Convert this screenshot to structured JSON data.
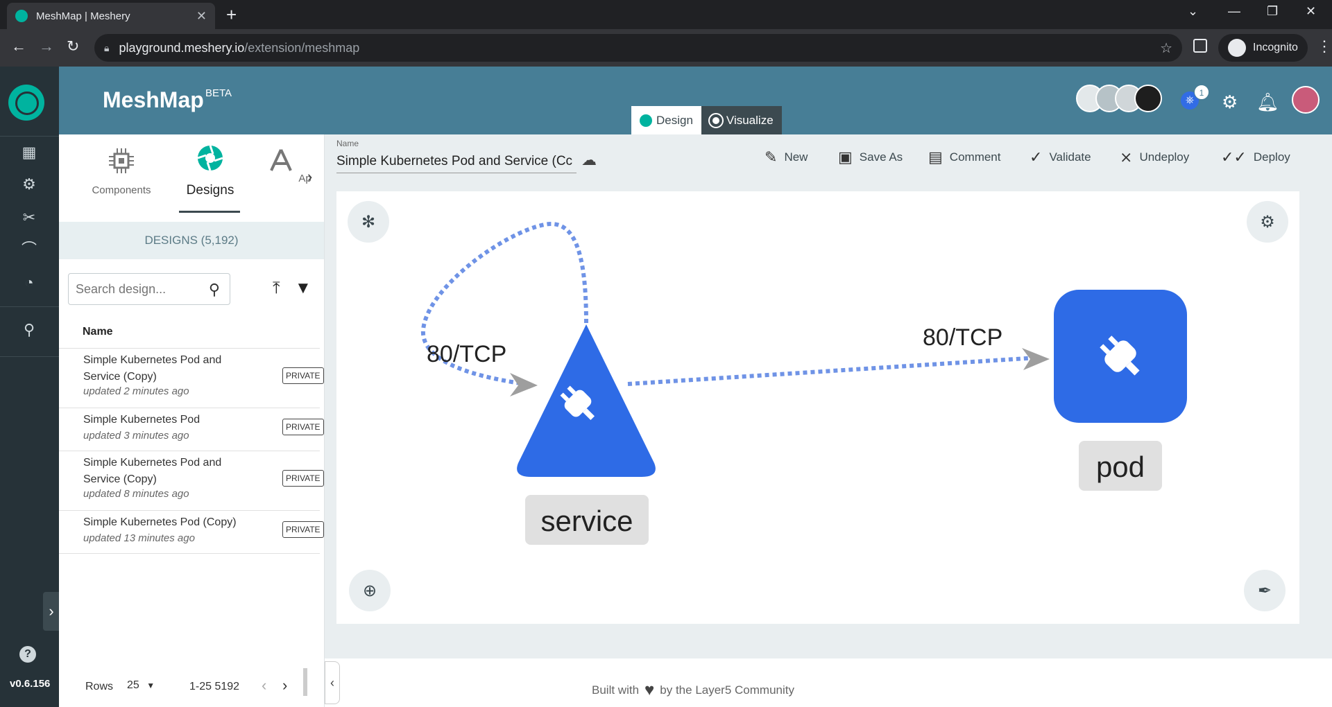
{
  "browser": {
    "tab_title": "MeshMap | Meshery",
    "url_host": "playground.meshery.io",
    "url_path": "/extension/meshmap",
    "incognito_label": "Incognito"
  },
  "sidebar": {
    "version": "v0.6.156",
    "icons": [
      "dashboard-icon",
      "lifecycle-icon",
      "configuration-icon",
      "performance-icon",
      "extensions-icon",
      "location-icon"
    ]
  },
  "header": {
    "title": "MeshMap",
    "beta": "BETA",
    "k8s_badge": "1",
    "mode_tabs": [
      {
        "label": "Design",
        "active": true
      },
      {
        "label": "Visualize",
        "active": false
      }
    ]
  },
  "panel": {
    "tabs": [
      {
        "label": "Components"
      },
      {
        "label": "Designs"
      },
      {
        "label": "Applicatio"
      }
    ],
    "designs_count": "DESIGNS (5,192)",
    "search_placeholder": "Search design...",
    "column_name": "Name",
    "designs": [
      {
        "name_line1": "Simple Kubernetes Pod and",
        "name_line2": "Service (Copy)",
        "updated": "updated 2 minutes ago",
        "visibility": "PRIVATE"
      },
      {
        "name_line1": "Simple Kubernetes Pod",
        "name_line2": "",
        "updated": "updated 3 minutes ago",
        "visibility": "PRIVATE"
      },
      {
        "name_line1": "Simple Kubernetes Pod and",
        "name_line2": "Service (Copy)",
        "updated": "updated 8 minutes ago",
        "visibility": "PRIVATE"
      },
      {
        "name_line1": "Simple Kubernetes Pod (Copy)",
        "name_line2": "",
        "updated": "updated 13 minutes ago",
        "visibility": "PRIVATE"
      }
    ],
    "pager": {
      "rows_label": "Rows",
      "rows_per_page": "25",
      "range": "1-25 5192"
    }
  },
  "design": {
    "name_label": "Name",
    "name_value": "Simple Kubernetes Pod and Service (Cc",
    "actions": [
      {
        "label": "New",
        "icon": "pencil-icon"
      },
      {
        "label": "Save As",
        "icon": "save-icon"
      },
      {
        "label": "Comment",
        "icon": "comment-icon"
      },
      {
        "label": "Validate",
        "icon": "check-icon"
      },
      {
        "label": "Undeploy",
        "icon": "undeploy-icon"
      },
      {
        "label": "Deploy",
        "icon": "deploy-icon"
      }
    ]
  },
  "canvas": {
    "nodes": [
      {
        "id": "service",
        "label": "service",
        "shape": "triangle",
        "color": "#2e6be6"
      },
      {
        "id": "pod",
        "label": "pod",
        "shape": "rounded-square",
        "color": "#2e6be6"
      }
    ],
    "edges": [
      {
        "from": "service",
        "to": "service",
        "label": "80/TCP"
      },
      {
        "from": "service",
        "to": "pod",
        "label": "80/TCP"
      }
    ],
    "edge_color": "#6f93e6"
  },
  "footer": {
    "built_with": "Built with",
    "by": "by the Layer5 Community"
  },
  "colors": {
    "header_bg": "#477e96",
    "sidebar_bg": "#263238",
    "accent": "#00b39f"
  }
}
